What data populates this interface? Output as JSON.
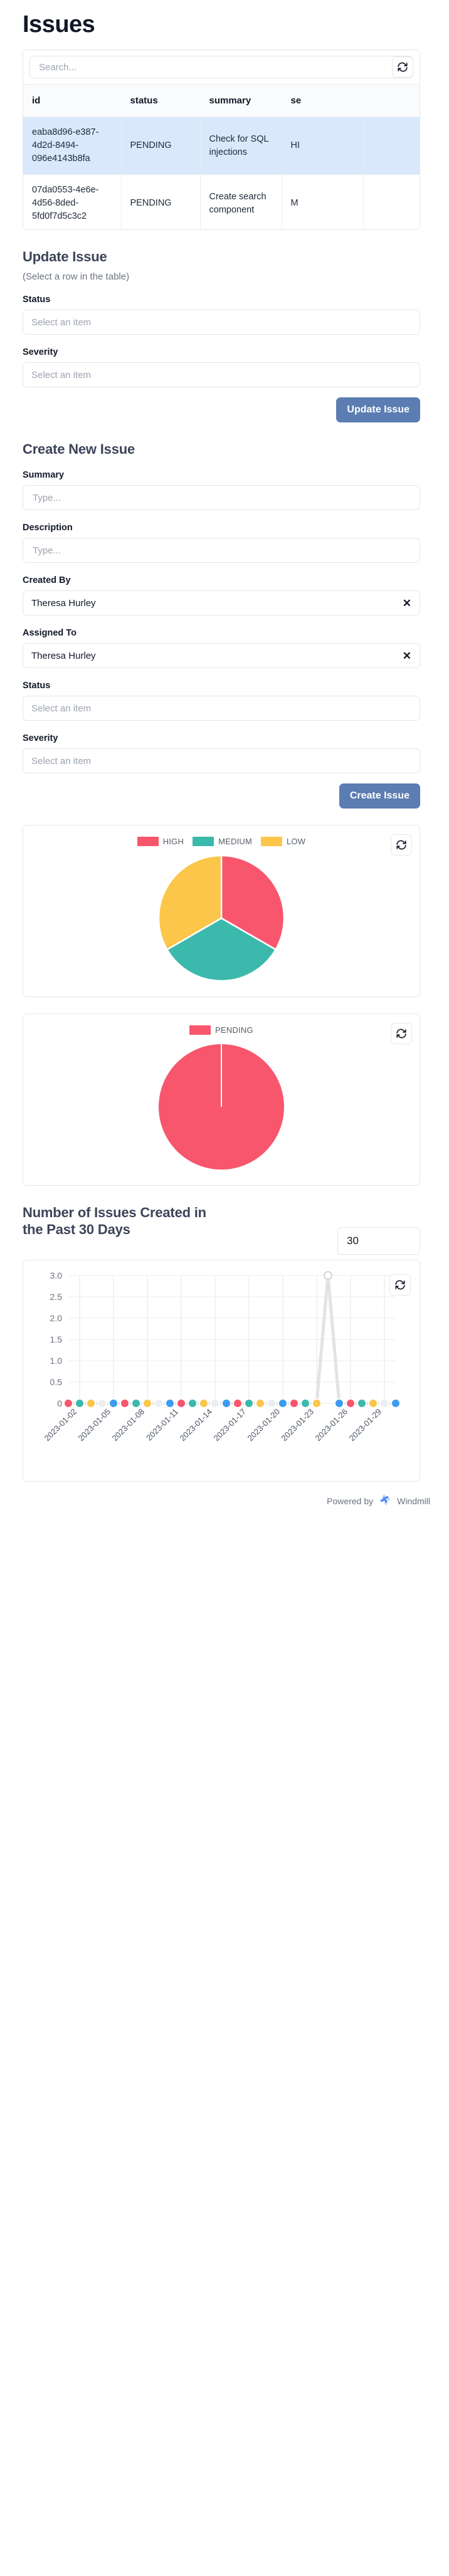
{
  "page": {
    "title": "Issues"
  },
  "table": {
    "search_placeholder": "Search...",
    "search_value": "",
    "refresh_icon": "refresh-icon",
    "columns": [
      "id",
      "status",
      "summary",
      "se",
      ""
    ],
    "rows": [
      {
        "id": "eaba8d96-e387-4d2d-8494-096e4143b8fa",
        "status": "PENDING",
        "summary": "Check for SQL injections",
        "severity": "HI",
        "extra": "",
        "selected": true
      },
      {
        "id": "07da0553-4e6e-4d56-8ded-5fd0f7d5c3c2",
        "status": "PENDING",
        "summary": "Create search component",
        "severity": "M",
        "extra": "",
        "selected": false
      }
    ]
  },
  "update_issue": {
    "heading": "Update Issue",
    "hint": "(Select a row in the table)",
    "status_label": "Status",
    "status_placeholder": "Select an item",
    "severity_label": "Severity",
    "severity_placeholder": "Select an item",
    "submit_label": "Update Issue"
  },
  "create_issue": {
    "heading": "Create New Issue",
    "summary_label": "Summary",
    "summary_placeholder": "Type...",
    "summary_value": "",
    "description_label": "Description",
    "description_placeholder": "Type...",
    "description_value": "",
    "created_by_label": "Created By",
    "created_by_value": "Theresa Hurley",
    "assigned_to_label": "Assigned To",
    "assigned_to_value": "Theresa Hurley",
    "status_label": "Status",
    "status_placeholder": "Select an item",
    "severity_label": "Severity",
    "severity_placeholder": "Select an item",
    "submit_label": "Create Issue",
    "clear_icon": "close-icon"
  },
  "line_chart_controls": {
    "title": "Number of Issues Created in the Past 30 Days",
    "days_value": "30"
  },
  "footer": {
    "powered_by": "Powered by",
    "brand": "Windmill"
  },
  "colors": {
    "accent": "#5b7db1",
    "high": "#f8566d",
    "medium": "#3bb9ad",
    "low": "#fbc64a",
    "pending": "#f8566d",
    "row_selected": "#d9e8fb"
  },
  "chart_data": [
    {
      "type": "pie",
      "title": "",
      "legend_position": "top",
      "labels": [
        "HIGH",
        "MEDIUM",
        "LOW"
      ],
      "values": [
        1,
        1,
        1
      ],
      "percentages": [
        33.3,
        33.3,
        33.3
      ],
      "colors": [
        "#f8566d",
        "#3bb9ad",
        "#fbc64a"
      ]
    },
    {
      "type": "pie",
      "title": "",
      "legend_position": "top",
      "labels": [
        "PENDING"
      ],
      "values": [
        1
      ],
      "percentages": [
        100
      ],
      "colors": [
        "#f8566d"
      ]
    },
    {
      "type": "line",
      "title": "Number of Issues Created in the Past 30 Days",
      "xlabel": "",
      "ylabel": "",
      "ylim": [
        0,
        3.0
      ],
      "yticks": [
        0,
        0.5,
        1.0,
        1.5,
        2.0,
        2.5,
        3.0
      ],
      "ytick_labels": [
        "0",
        "0.5",
        "1.0",
        "1.5",
        "2.0",
        "2.5",
        "3.0"
      ],
      "grid": true,
      "x": [
        "2023-01-01",
        "2023-01-02",
        "2023-01-03",
        "2023-01-04",
        "2023-01-05",
        "2023-01-06",
        "2023-01-07",
        "2023-01-08",
        "2023-01-09",
        "2023-01-10",
        "2023-01-11",
        "2023-01-12",
        "2023-01-13",
        "2023-01-14",
        "2023-01-15",
        "2023-01-16",
        "2023-01-17",
        "2023-01-18",
        "2023-01-19",
        "2023-01-20",
        "2023-01-21",
        "2023-01-22",
        "2023-01-23",
        "2023-01-24",
        "2023-01-25",
        "2023-01-26",
        "2023-01-27",
        "2023-01-28",
        "2023-01-29",
        "2023-01-30"
      ],
      "xtick_labels": [
        "2023-01-02",
        "2023-01-05",
        "2023-01-08",
        "2023-01-11",
        "2023-01-14",
        "2023-01-17",
        "2023-01-20",
        "2023-01-23",
        "2023-01-26",
        "2023-01-29"
      ],
      "values": [
        0,
        0,
        0,
        0,
        0,
        0,
        0,
        0,
        0,
        0,
        0,
        0,
        0,
        0,
        0,
        0,
        0,
        0,
        0,
        0,
        0,
        0,
        0,
        3,
        0,
        0,
        0,
        0,
        0,
        0
      ],
      "point_colors": [
        "#f8566d",
        "#3bb9ad",
        "#fbc64a",
        "#eceef0",
        "#3b9cf0",
        "#f8566d",
        "#3bb9ad",
        "#fbc64a",
        "#eceef0",
        "#3b9cf0",
        "#f8566d",
        "#3bb9ad",
        "#fbc64a",
        "#eceef0",
        "#3b9cf0",
        "#f8566d",
        "#3bb9ad",
        "#fbc64a",
        "#eceef0",
        "#3b9cf0",
        "#f8566d",
        "#3bb9ad",
        "#fbc64a",
        "#eceef0",
        "#3b9cf0",
        "#f8566d",
        "#3bb9ad",
        "#fbc64a",
        "#eceef0",
        "#3b9cf0"
      ],
      "line_color": "#e3e3e3"
    }
  ]
}
